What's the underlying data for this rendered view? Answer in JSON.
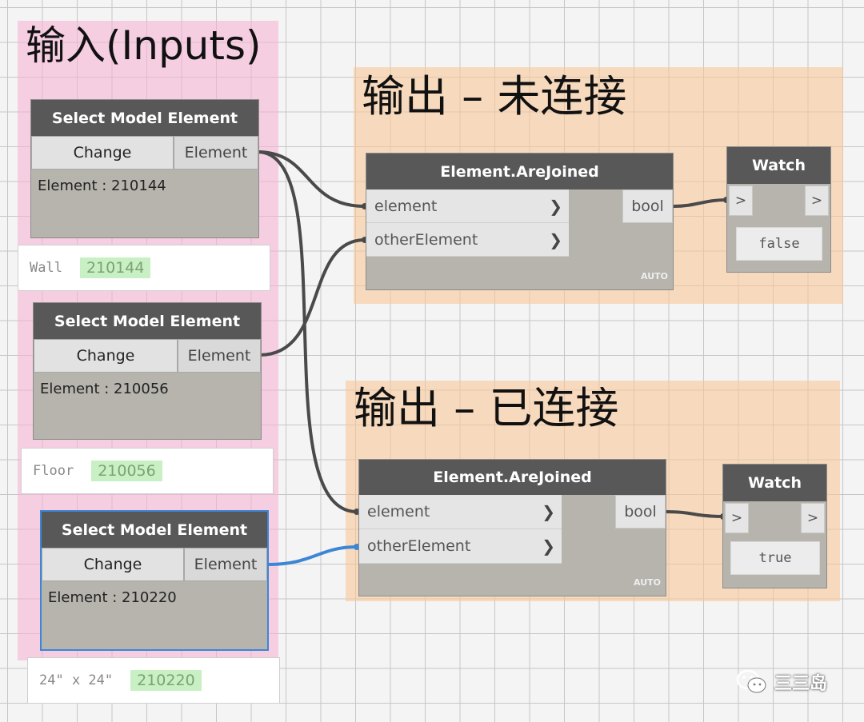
{
  "groups": {
    "inputs_title": "输入(Inputs)",
    "unconnected_title": "输出 – 未连接",
    "connected_title": "输出 – 已连接"
  },
  "select_nodes": [
    {
      "title": "Select Model Element",
      "button": "Change",
      "port": "Element",
      "value": "Element : 210144"
    },
    {
      "title": "Select Model Element",
      "button": "Change",
      "port": "Element",
      "value": "Element : 210056"
    },
    {
      "title": "Select Model Element",
      "button": "Change",
      "port": "Element",
      "value": "Element : 210220"
    }
  ],
  "previews": [
    {
      "type": "Wall",
      "id": "210144"
    },
    {
      "type": "Floor",
      "id": "210056"
    },
    {
      "type": "24\" x 24\"",
      "id": "210220"
    }
  ],
  "arejoined_nodes": [
    {
      "title": "Element.AreJoined",
      "in1": "element",
      "in2": "otherElement",
      "out": "bool",
      "lacing": "AUTO"
    },
    {
      "title": "Element.AreJoined",
      "in1": "element",
      "in2": "otherElement",
      "out": "bool",
      "lacing": "AUTO"
    }
  ],
  "watch_nodes": [
    {
      "title": "Watch",
      "in": ">",
      "out": ">",
      "value": "false"
    },
    {
      "title": "Watch",
      "in": ">",
      "out": ">",
      "value": "true"
    }
  ],
  "colors": {
    "wire": "#4a4a4a",
    "selected_wire": "#3d86d6",
    "pink_group": "#f6b4d6",
    "orange_group": "#fac896"
  },
  "watermark": {
    "text": "三三岛",
    "icon": "wechat-icon"
  }
}
